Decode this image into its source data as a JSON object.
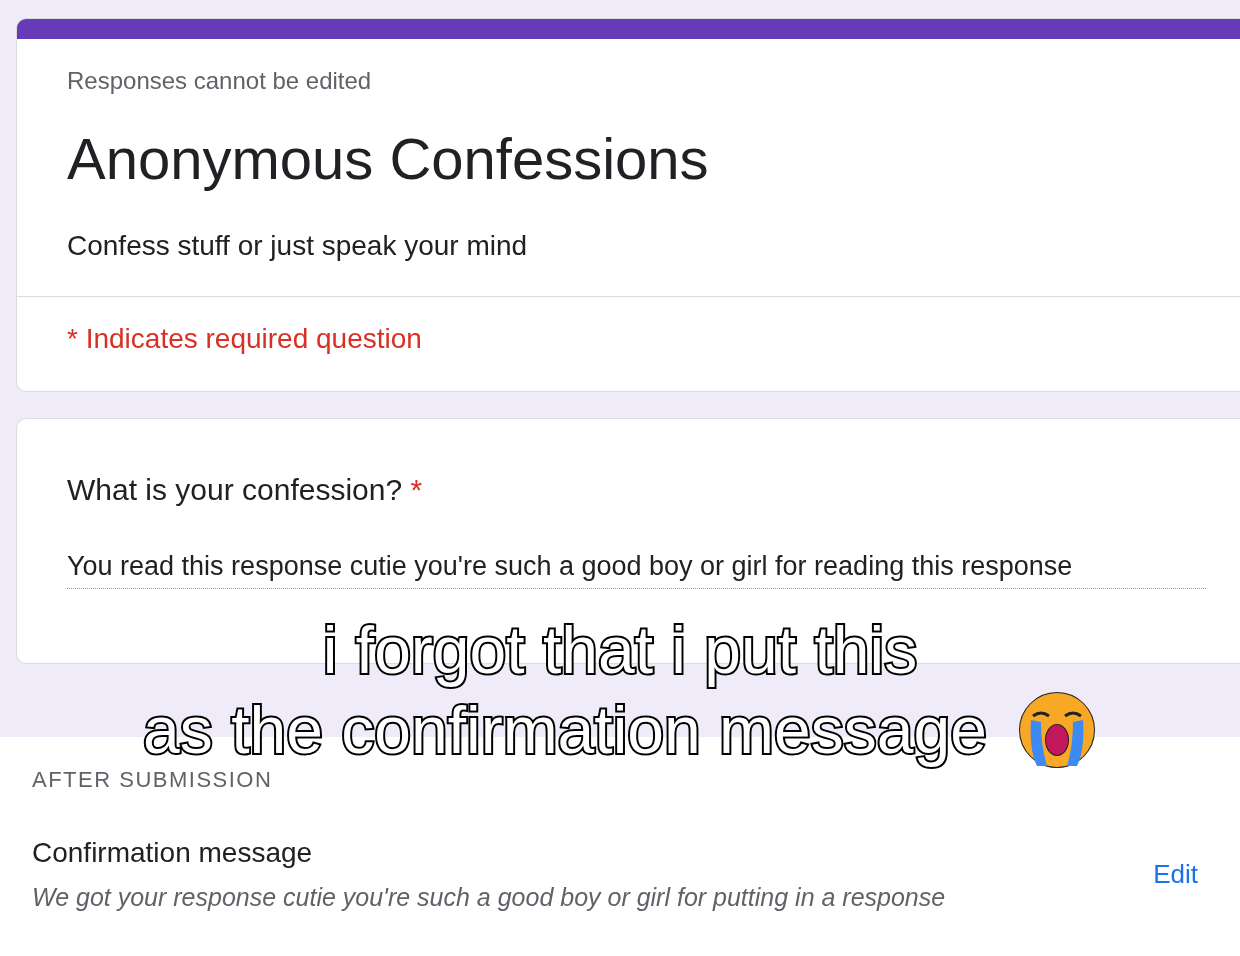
{
  "form": {
    "notice": "Responses cannot be edited",
    "title": "Anonymous Confessions",
    "description": "Confess stuff or just speak your mind",
    "required_note": "* Indicates required question"
  },
  "question": {
    "label": "What is your confession?",
    "required_mark": "*",
    "answer": "You read this response cutie you're such a good boy or girl for reading this response"
  },
  "settings": {
    "section": "AFTER SUBMISSION",
    "label": "Confirmation message",
    "value": "We got your response cutie you're such a good boy or girl for putting in a response",
    "edit_link": "Edit"
  },
  "caption": {
    "lines": [
      "i forgot that i put this",
      "as the confirmation message"
    ]
  }
}
